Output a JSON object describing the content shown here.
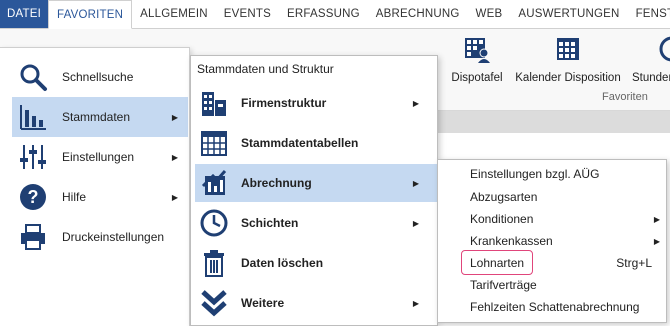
{
  "tabs": [
    "DATEI",
    "FAVORITEN",
    "ALLGEMEIN",
    "EVENTS",
    "ERFASSUNG",
    "ABRECHNUNG",
    "WEB",
    "AUSWERTUNGEN",
    "FENSTER"
  ],
  "ribbon": {
    "buttons": [
      "Dispotafel",
      "Kalender Disposition",
      "Stunden"
    ],
    "group_label": "Favoriten"
  },
  "menu1": [
    {
      "label": "Schnellsuche",
      "icon": "magnifier-icon",
      "submenu": false
    },
    {
      "label": "Stammdaten",
      "icon": "bar-chart-icon",
      "submenu": true,
      "selected": true
    },
    {
      "label": "Einstellungen",
      "icon": "sliders-icon",
      "submenu": true
    },
    {
      "label": "Hilfe",
      "icon": "help-icon",
      "submenu": true
    },
    {
      "label": "Druckeinstellungen",
      "icon": "printer-icon",
      "submenu": false
    }
  ],
  "menu2": {
    "title": "Stammdaten und Struktur",
    "items": [
      {
        "label": "Firmenstruktur",
        "icon": "buildings-icon",
        "submenu": true
      },
      {
        "label": "Stammdatentabellen",
        "icon": "table-icon",
        "submenu": false
      },
      {
        "label": "Abrechnung",
        "icon": "invoice-icon",
        "submenu": true,
        "selected": true
      },
      {
        "label": "Schichten",
        "icon": "clock-icon",
        "submenu": true
      },
      {
        "label": "Daten löschen",
        "icon": "trash-icon",
        "submenu": false
      },
      {
        "label": "Weitere",
        "icon": "double-chevron-icon",
        "submenu": true
      }
    ]
  },
  "menu3": [
    {
      "label": "Einstellungen bzgl. AÜG",
      "submenu": false,
      "shortcut": ""
    },
    {
      "label": "Abzugsarten",
      "submenu": false,
      "shortcut": ""
    },
    {
      "label": "Konditionen",
      "submenu": true,
      "shortcut": ""
    },
    {
      "label": "Krankenkassen",
      "submenu": true,
      "shortcut": ""
    },
    {
      "label": "Lohnarten",
      "submenu": false,
      "shortcut": "Strg+L",
      "highlighted": true
    },
    {
      "label": "Tarifverträge",
      "submenu": false,
      "shortcut": ""
    },
    {
      "label": "Fehlzeiten Schattenabrechnung",
      "submenu": false,
      "shortcut": ""
    }
  ],
  "colors": {
    "accent": "#2b579a",
    "selection": "#c5d9f1",
    "highlight": "#e0457b"
  }
}
